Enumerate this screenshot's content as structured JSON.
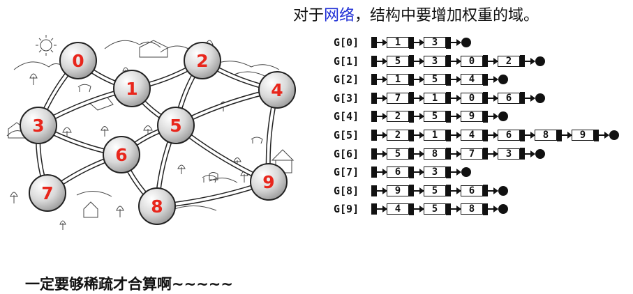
{
  "title": {
    "prefix": "对于",
    "highlight": "网络",
    "suffix": "，结构中要增加权重的域。"
  },
  "bottom_note": "一定要够稀疏才合算啊~~~~~",
  "colors": {
    "node_label": "#e8261c",
    "node_fill": "#d9d9d9",
    "highlight_text": "#1f2fd6",
    "ink": "#111111"
  },
  "graph": {
    "vertices": [
      "0",
      "1",
      "2",
      "3",
      "4",
      "5",
      "6",
      "7",
      "8",
      "9"
    ]
  },
  "adjacency": [
    {
      "label": "G[0]",
      "items": [
        "1",
        "3"
      ]
    },
    {
      "label": "G[1]",
      "items": [
        "5",
        "3",
        "0",
        "2"
      ]
    },
    {
      "label": "G[2]",
      "items": [
        "1",
        "5",
        "4"
      ]
    },
    {
      "label": "G[3]",
      "items": [
        "7",
        "1",
        "0",
        "6"
      ]
    },
    {
      "label": "G[4]",
      "items": [
        "2",
        "5",
        "9"
      ]
    },
    {
      "label": "G[5]",
      "items": [
        "2",
        "1",
        "4",
        "6",
        "8",
        "9"
      ]
    },
    {
      "label": "G[6]",
      "items": [
        "5",
        "8",
        "7",
        "3"
      ]
    },
    {
      "label": "G[7]",
      "items": [
        "6",
        "3"
      ]
    },
    {
      "label": "G[8]",
      "items": [
        "9",
        "5",
        "6"
      ]
    },
    {
      "label": "G[9]",
      "items": [
        "4",
        "5",
        "8"
      ]
    }
  ]
}
